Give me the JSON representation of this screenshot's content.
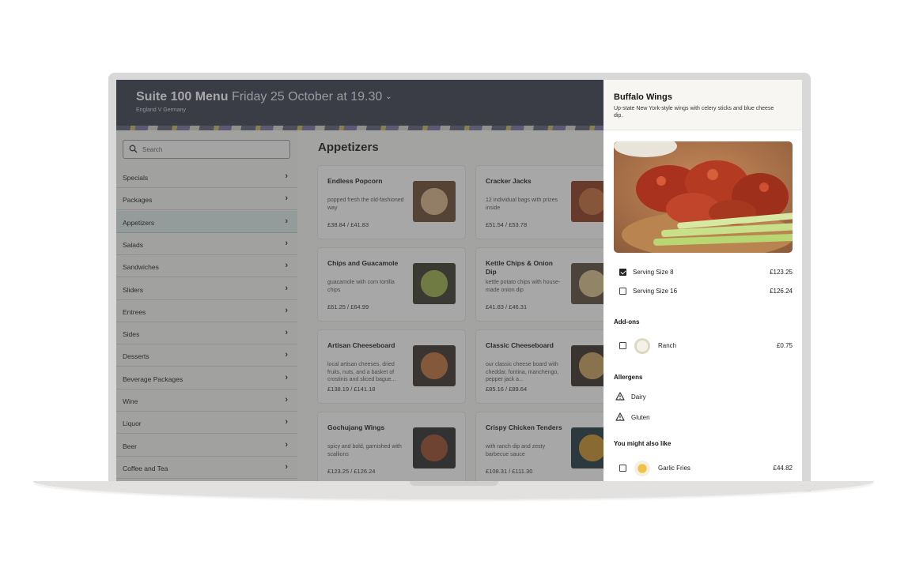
{
  "header": {
    "title": "Suite 100 Menu",
    "date": "Friday 25 October at 19.30",
    "subtitle": "England V Germany"
  },
  "search": {
    "placeholder": "Search"
  },
  "sidebar": {
    "items": [
      {
        "label": "Specials"
      },
      {
        "label": "Packages"
      },
      {
        "label": "Appetizers"
      },
      {
        "label": "Salads"
      },
      {
        "label": "Sandwiches"
      },
      {
        "label": "Sliders"
      },
      {
        "label": "Entrees"
      },
      {
        "label": "Sides"
      },
      {
        "label": "Desserts"
      },
      {
        "label": "Beverage Packages"
      },
      {
        "label": "Wine"
      },
      {
        "label": "Liquor"
      },
      {
        "label": "Beer"
      },
      {
        "label": "Coffee and Tea"
      }
    ]
  },
  "section": {
    "title": "Appetizers"
  },
  "cards": [
    {
      "name": "Endless Popcorn",
      "desc": "popped fresh the old-fashioned way",
      "price": "£38.84 / £41.83"
    },
    {
      "name": "Cracker Jacks",
      "desc": "12 individual bags with prizes inside",
      "price": "£51.54 / £53.78"
    },
    {
      "name": "Chips and Guacamole",
      "desc": "guacamole with corn tortilla chips",
      "price": "£61.25 / £64.99"
    },
    {
      "name": "Kettle Chips & Onion Dip",
      "desc": "kettle potato chips with house-made onion dip",
      "price": "£41.83 / £46.31"
    },
    {
      "name": "Artisan Cheeseboard",
      "desc": "local artisan cheeses, dried fruits, nuts, and a basket of crostinis and sliced bague...",
      "price": "£138.19 / £141.18"
    },
    {
      "name": "Classic Cheeseboard",
      "desc": "our classic cheese board with cheddar, fontina, manchengo, pepper jack a...",
      "price": "£85.16 / £89.64"
    },
    {
      "name": "Gochujang Wings",
      "desc": "spicy and bold, garnished with scallions",
      "price": "£123.25 / £126.24"
    },
    {
      "name": "Crispy Chicken Tenders",
      "desc": "with ranch dip and zesty barbecue sauce",
      "price": "£108.31 / £111.30"
    }
  ],
  "panel": {
    "title": "Buffalo Wings",
    "desc": "Up-state New York-style wings with celery sticks and blue cheese dip.",
    "sizes": [
      {
        "label": "Serving Size 8",
        "price": "£123.25",
        "checked": true
      },
      {
        "label": "Serving Size 16",
        "price": "£126.24",
        "checked": false
      }
    ],
    "addons_title": "Add-ons",
    "addons": [
      {
        "label": "Ranch",
        "price": "£0.75"
      }
    ],
    "allergens_title": "Allergens",
    "allergens": [
      {
        "label": "Dairy"
      },
      {
        "label": "Gluten"
      }
    ],
    "also_title": "You might also like",
    "also": [
      {
        "label": "Garlic Fries",
        "price": "£44.82"
      }
    ]
  }
}
